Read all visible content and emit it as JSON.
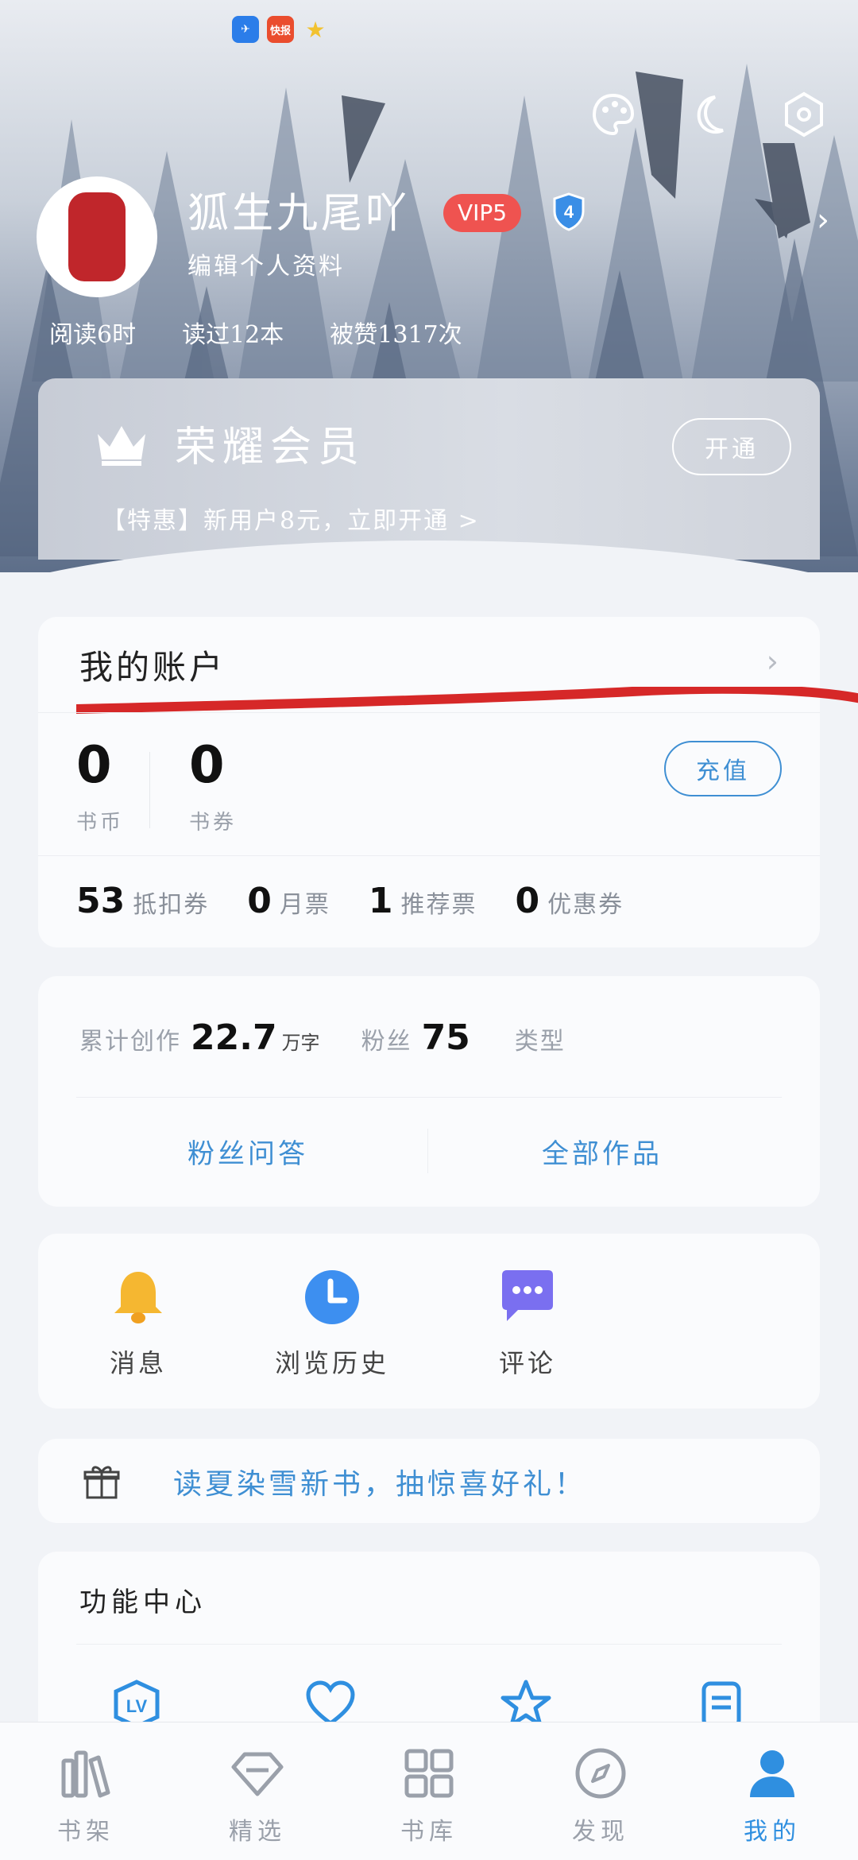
{
  "status_bar": {
    "icons": [
      "feishu-app-icon",
      "kuaibao-app-icon",
      "star-app-icon"
    ],
    "kuaibao_label": "快报"
  },
  "profile": {
    "username": "狐生九尾吖",
    "vip_label": "VIP5",
    "level": "4",
    "edit_label": "编辑个人资料",
    "stats": [
      "阅读6时",
      "读过12本",
      "被赞1317次"
    ]
  },
  "member": {
    "title": "荣耀会员",
    "open_label": "开通",
    "promo": "【特惠】新用户8元，立即开通 >"
  },
  "account": {
    "title": "我的账户",
    "coins": [
      {
        "value": "0",
        "label": "书币"
      },
      {
        "value": "0",
        "label": "书券"
      }
    ],
    "recharge_label": "充值",
    "tickets": [
      {
        "value": "53",
        "label": "抵扣券"
      },
      {
        "value": "0",
        "label": "月票"
      },
      {
        "value": "1",
        "label": "推荐票"
      },
      {
        "value": "0",
        "label": "优惠券"
      }
    ]
  },
  "author": {
    "created_label": "累计创作",
    "created_value": "22.7",
    "created_unit": "万字",
    "fans_label": "粉丝",
    "fans_value": "75",
    "type_label": "类型",
    "link_qa": "粉丝问答",
    "link_works": "全部作品"
  },
  "quick": [
    {
      "label": "消息",
      "icon": "bell-icon"
    },
    {
      "label": "浏览历史",
      "icon": "clock-icon"
    },
    {
      "label": "评论",
      "icon": "comment-icon"
    }
  ],
  "promo_banner": {
    "text": "读夏染雪新书，抽惊喜好礼！",
    "icon": "gift-icon"
  },
  "function_center": {
    "title": "功能中心",
    "icons": [
      "level-icon",
      "heart-icon",
      "star-icon",
      "document-icon"
    ]
  },
  "bottom_nav": [
    {
      "label": "书架",
      "icon": "bookshelf-icon",
      "active": false
    },
    {
      "label": "精选",
      "icon": "diamond-icon",
      "active": false
    },
    {
      "label": "书库",
      "icon": "grid-icon",
      "active": false
    },
    {
      "label": "发现",
      "icon": "compass-icon",
      "active": false
    },
    {
      "label": "我的",
      "icon": "user-icon",
      "active": true
    }
  ],
  "colors": {
    "accent": "#3f8fd3",
    "vip_red": "#ef5350",
    "annotation_red": "#d62828"
  }
}
